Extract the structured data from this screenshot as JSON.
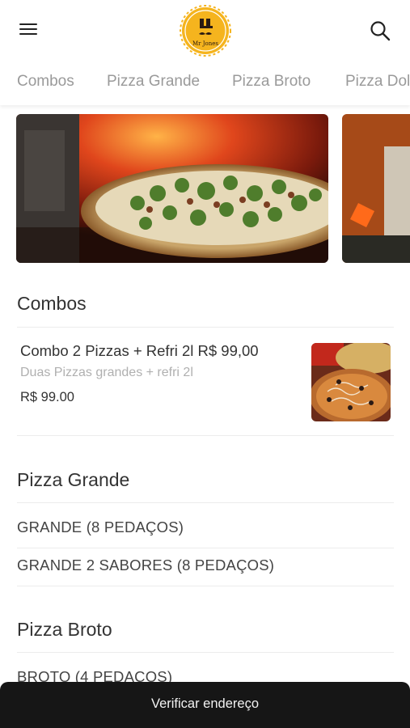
{
  "header": {
    "logo_text": "Mr Jones",
    "menu_icon": "hamburger-menu-icon",
    "search_icon": "search-icon",
    "brand_color": "#F5B41E"
  },
  "categories": [
    "Combos",
    "Pizza Grande",
    "Pizza Broto",
    "Pizza Dol"
  ],
  "sections": {
    "combos": {
      "title": "Combos",
      "product": {
        "name": "Combo 2 Pizzas + Refri 2l R$ 99,00",
        "description": "Duas Pizzas grandes + refri 2l",
        "price": "R$ 99.00"
      }
    },
    "pizza_grande": {
      "title": "Pizza Grande",
      "items": [
        "GRANDE (8 PEDAÇOS)",
        "GRANDE 2 SABORES (8 PEDAÇOS)"
      ]
    },
    "pizza_broto": {
      "title": "Pizza Broto",
      "items": [
        "BROTO (4 PEDAÇOS)"
      ]
    }
  },
  "bottom_bar": {
    "label": "Verificar endereço"
  }
}
